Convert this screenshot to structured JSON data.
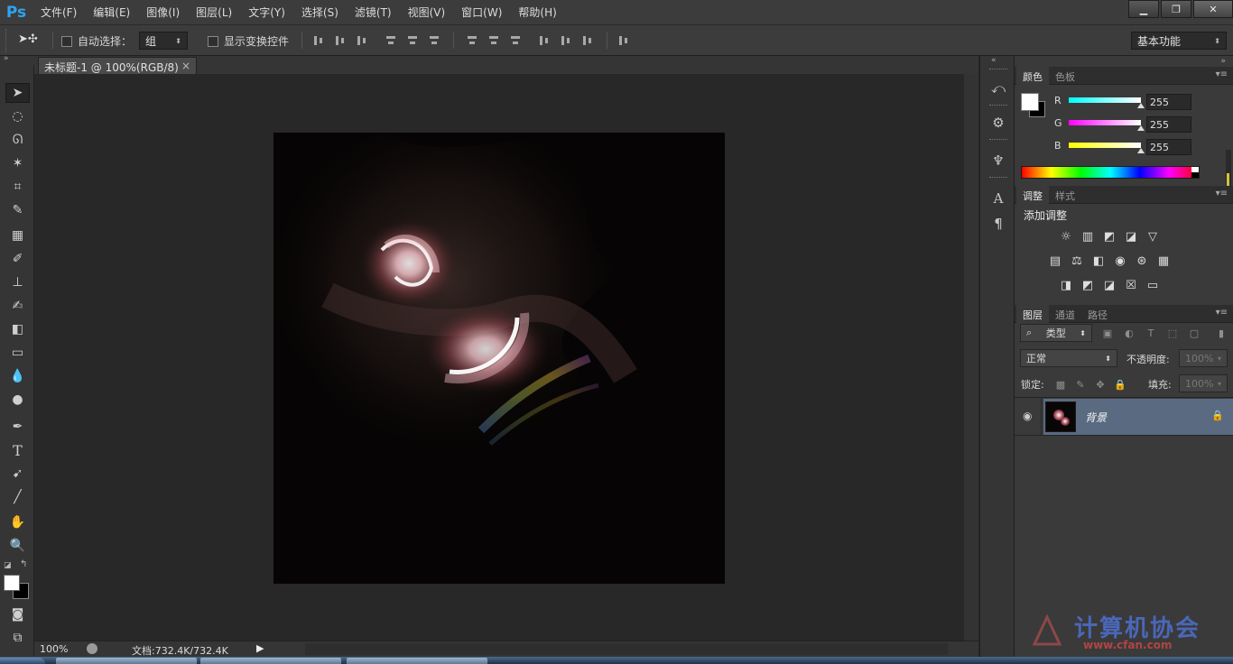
{
  "app": {
    "logo": "Ps",
    "menu": [
      "文件(F)",
      "编辑(E)",
      "图像(I)",
      "图层(L)",
      "文字(Y)",
      "选择(S)",
      "滤镜(T)",
      "视图(V)",
      "窗口(W)",
      "帮助(H)"
    ],
    "window_controls": [
      "minimize-icon",
      "restore-icon",
      "close-icon"
    ]
  },
  "options": {
    "auto_select_label": "自动选择：",
    "auto_select_checked": false,
    "auto_select_target": "组",
    "show_transform_label": "显示变换控件",
    "show_transform_checked": false,
    "workspace": "基本功能"
  },
  "document": {
    "tab_title": "未标题-1 @ 100%(RGB/8) *",
    "zoom": "100%",
    "doc_size": "文档:732.4K/732.4K"
  },
  "tools": [
    "move-tool",
    "marquee-tool",
    "lasso-tool",
    "magic-wand-tool",
    "crop-tool",
    "eyedropper-tool",
    "spot-healing-tool",
    "brush-tool",
    "clone-stamp-tool",
    "history-brush-tool",
    "eraser-tool",
    "gradient-tool",
    "blur-tool",
    "dodge-tool",
    "pen-tool",
    "type-tool",
    "path-selection-tool",
    "line-tool",
    "hand-tool",
    "zoom-tool"
  ],
  "colors": {
    "foreground": "#ffffff",
    "background": "#000000",
    "accent_selection": "#5a6a80"
  },
  "color_panel": {
    "tabs": [
      "颜色",
      "色板"
    ],
    "active_tab": "颜色",
    "channels": [
      {
        "label": "R",
        "value": "255"
      },
      {
        "label": "G",
        "value": "255"
      },
      {
        "label": "B",
        "value": "255"
      }
    ]
  },
  "adjustments_panel": {
    "tabs": [
      "调整",
      "样式"
    ],
    "active_tab": "调整",
    "heading": "添加调整",
    "rows": [
      [
        "brightness-icon",
        "levels-icon",
        "curves-icon",
        "exposure-icon",
        "vibrance-icon"
      ],
      [
        "hue-saturation-icon",
        "color-balance-icon",
        "black-white-icon",
        "photo-filter-icon",
        "channel-mixer-icon",
        "color-lookup-icon"
      ],
      [
        "invert-icon",
        "posterize-icon",
        "threshold-icon",
        "selective-color-icon",
        "gradient-map-icon"
      ]
    ]
  },
  "layers_panel": {
    "tabs": [
      "图层",
      "通道",
      "路径"
    ],
    "active_tab": "图层",
    "filter_kind": "类型",
    "blend_mode": "正常",
    "opacity_label": "不透明度:",
    "opacity_value": "100%",
    "lock_label": "锁定:",
    "fill_label": "填充:",
    "fill_value": "100%",
    "layers": [
      {
        "name": "背景",
        "visible": true,
        "locked": true,
        "selected": true
      }
    ]
  },
  "watermark": {
    "text": "计算机协会",
    "subtext": "www.cfan.com"
  }
}
